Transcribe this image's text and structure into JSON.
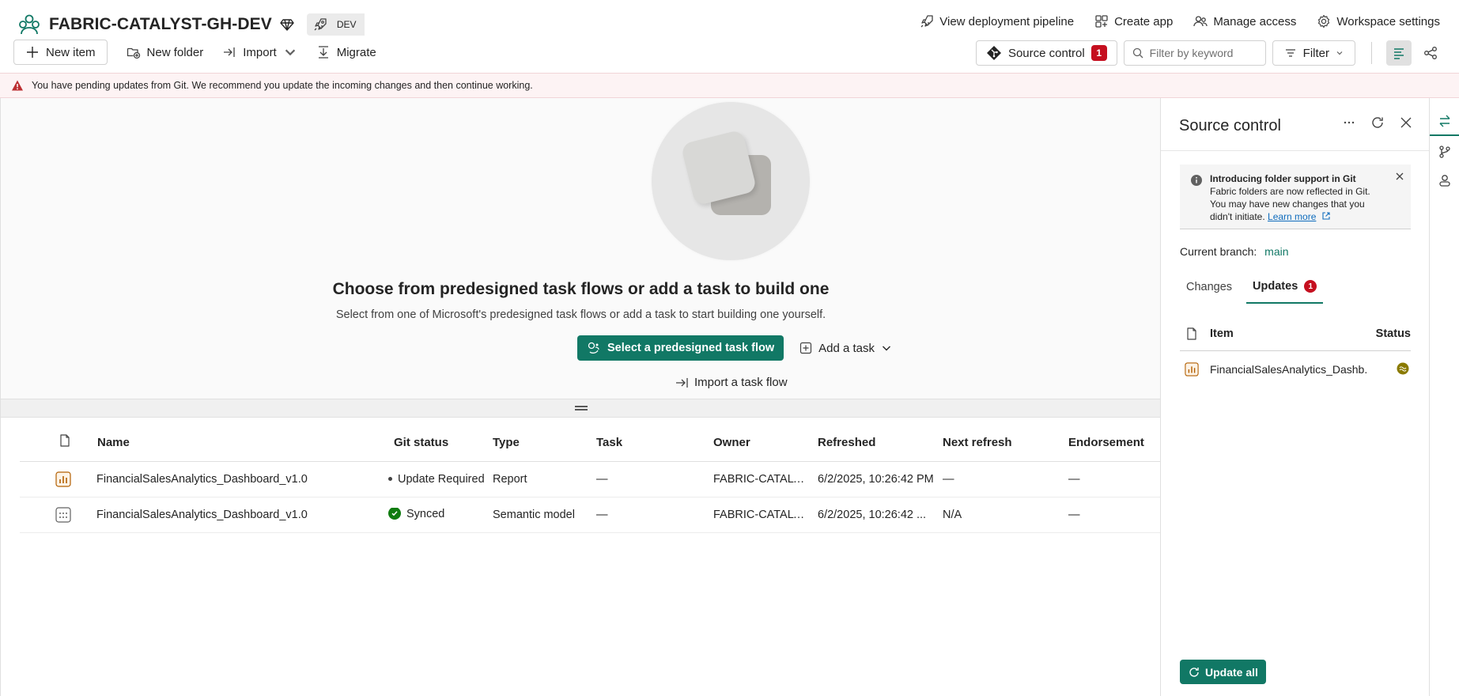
{
  "workspace": {
    "title": "FABRIC-CATALYST-GH-DEV",
    "stage_label": "DEV"
  },
  "top_links": {
    "deployment": "View deployment pipeline",
    "create_app": "Create app",
    "manage_access": "Manage access",
    "settings": "Workspace settings"
  },
  "toolbar": {
    "new_item": "New item",
    "new_folder": "New folder",
    "import": "Import",
    "migrate": "Migrate",
    "source_control": "Source control",
    "source_control_count": "1",
    "filter_placeholder": "Filter by keyword",
    "filter": "Filter"
  },
  "banner": {
    "message": "You have pending updates from Git. We recommend you update the incoming changes and then continue working."
  },
  "hero": {
    "title": "Choose from predesigned task flows or add a task to build one",
    "subtitle": "Select from one of Microsoft's predesigned task flows or add a task to start building one yourself.",
    "primary": "Select a predesigned task flow",
    "add_task": "Add a task",
    "import_flow": "Import a task flow"
  },
  "table": {
    "headers": {
      "name": "Name",
      "git_status": "Git status",
      "type": "Type",
      "task": "Task",
      "owner": "Owner",
      "refreshed": "Refreshed",
      "next_refresh": "Next refresh",
      "endorsement": "Endorsement"
    },
    "rows": [
      {
        "icon": "report-icon",
        "name": "FinancialSalesAnalytics_Dashboard_v1.0",
        "git_status": "Update Required",
        "type": "Report",
        "task": "—",
        "owner": "FABRIC-CATALYS...",
        "refreshed": "6/2/2025, 10:26:42 PM",
        "next_refresh": "—",
        "endorsement": "—"
      },
      {
        "icon": "semantic-model-icon",
        "name": "FinancialSalesAnalytics_Dashboard_v1.0",
        "git_status": "Synced",
        "type": "Semantic model",
        "task": "—",
        "owner": "FABRIC-CATALYS...",
        "refreshed": "6/2/2025, 10:26:42 ...",
        "next_refresh": "N/A",
        "endorsement": "—"
      }
    ]
  },
  "panel": {
    "title": "Source control",
    "info_title": "Introducing folder support in Git",
    "info_body": "Fabric folders are now reflected in Git. You may have new changes that you didn't initiate.",
    "info_link": "Learn more",
    "branch_label": "Current branch:",
    "branch_value": "main",
    "tab_changes": "Changes",
    "tab_updates": "Updates",
    "updates_count": "1",
    "col_item": "Item",
    "col_status": "Status",
    "item_name": "FinancialSalesAnalytics_Dashb...",
    "update_all": "Update all"
  },
  "colors": {
    "accent": "#117865",
    "badge": "#c50f1f",
    "banner_bg": "#fdf3f4",
    "synced": "#107c10",
    "conflict": "#8a7a00"
  }
}
